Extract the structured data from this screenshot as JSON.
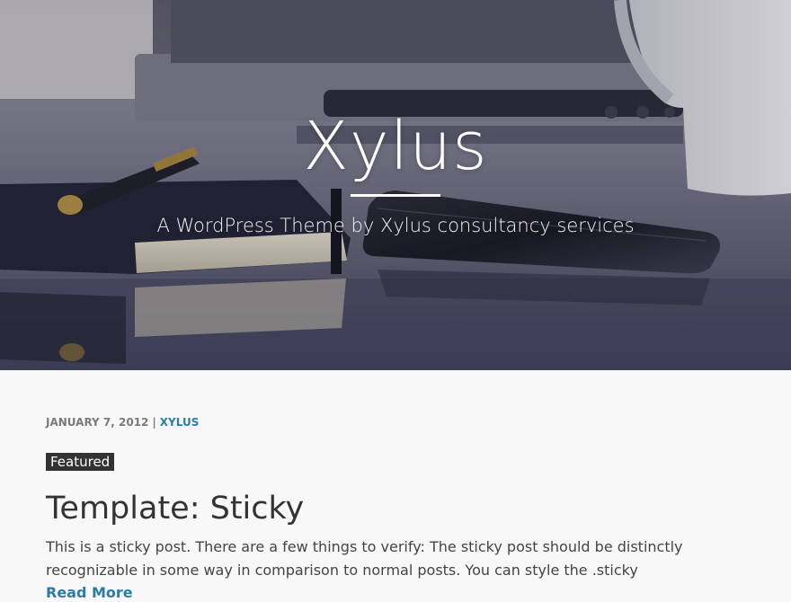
{
  "header": {
    "site_title": "Xylus",
    "tagline": "A WordPress Theme by Xylus consultancy services"
  },
  "post": {
    "date": "JANUARY 7, 2012",
    "separator": "|",
    "author": "XYLUS",
    "badge": "Featured",
    "title": "Template: Sticky",
    "excerpt": "This is a sticky post. There are a few things to verify: The sticky post should be distinctly recognizable in some way in comparison to normal posts. You can style the .sticky",
    "read_more": "Read More"
  },
  "colors": {
    "link": "#2b7ca6",
    "badge_bg": "#333333",
    "title_text": "#333333",
    "page_bg": "#f8f8f8"
  }
}
